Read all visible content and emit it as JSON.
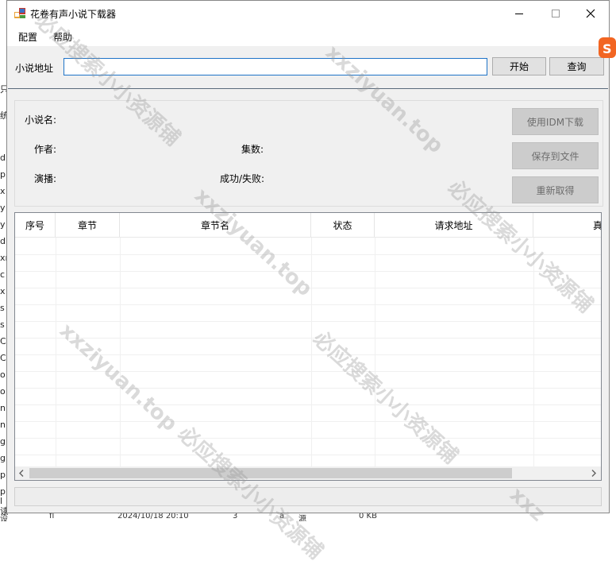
{
  "window": {
    "title": "花卷有声小说下载器"
  },
  "menu": {
    "items": [
      "配置",
      "帮助"
    ]
  },
  "url": {
    "label": "小说地址",
    "value": ""
  },
  "toolbar": {
    "start_label": "开始",
    "query_label": "查询"
  },
  "info": {
    "name_label": "小说名:",
    "author_label": "作者:",
    "episodes_label": "集数:",
    "narrator_label": "演播:",
    "success_fail_label": "成功/失败:"
  },
  "actions": {
    "idm_label": "使用IDM下载",
    "save_label": "保存到文件",
    "refetch_label": "重新取得"
  },
  "table": {
    "columns": [
      "序号",
      "章节",
      "章节名",
      "状态",
      "请求地址",
      "真"
    ]
  },
  "watermarks": [
    "xxziyuan.top",
    "必应搜索小小资源铺",
    "xxziyuan.top",
    "必应搜索小小资源铺",
    "xxziyuan.top",
    "必应搜索小小资源铺",
    "xxz"
  ],
  "background": {
    "left_chars": [
      "只",
      "统",
      "d",
      "p",
      "x",
      "y",
      "y",
      "dl",
      "xn",
      "c",
      "x",
      "s",
      "s",
      "C",
      "C",
      "o",
      "o",
      "n",
      "n",
      "g",
      "g",
      "p",
      "p",
      "l",
      "读"
    ],
    "bottom_text": [
      "设",
      "fl",
      "2024/10/18 20:10",
      "3",
      "a",
      "源",
      "0 KB"
    ]
  }
}
